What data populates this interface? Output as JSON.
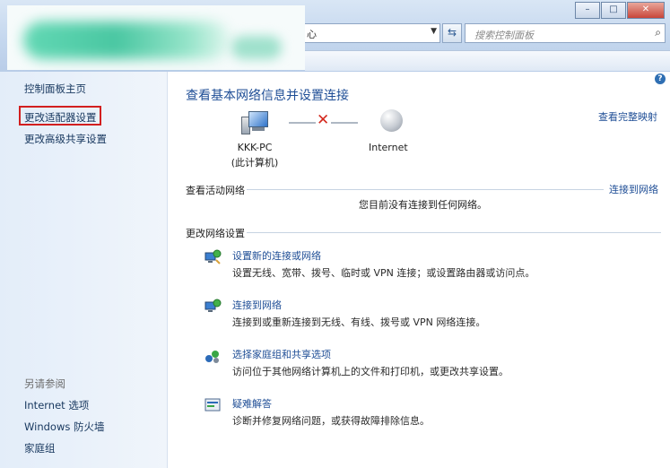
{
  "address": {
    "text": "心"
  },
  "search": {
    "placeholder": "搜索控制面板"
  },
  "window_buttons": {
    "minimize": "–",
    "maximize": "□",
    "close": "✕"
  },
  "left_pane": {
    "home": "控制面板主页",
    "change_adapter": "更改适配器设置",
    "advanced_sharing": "更改高级共享设置",
    "see_also": "另请参阅",
    "internet_options": "Internet 选项",
    "firewall": "Windows 防火墙",
    "homegroup": "家庭组"
  },
  "main": {
    "heading": "查看基本网络信息并设置连接",
    "full_map": "查看完整映射",
    "computer_name": "KKK-PC",
    "computer_sub": "(此计算机)",
    "internet_label": "Internet",
    "active_header": "查看活动网络",
    "connect_to_network": "连接到网络",
    "no_connection": "您目前没有连接到任何网络。",
    "change_header": "更改网络设置",
    "tasks": [
      {
        "icon": "network-setup-icon",
        "title": "设置新的连接或网络",
        "desc": "设置无线、宽带、拨号、临时或 VPN 连接；或设置路由器或访问点。"
      },
      {
        "icon": "connect-network-icon",
        "title": "连接到网络",
        "desc": "连接到或重新连接到无线、有线、拨号或 VPN 网络连接。"
      },
      {
        "icon": "homegroup-sharing-icon",
        "title": "选择家庭组和共享选项",
        "desc": "访问位于其他网络计算机上的文件和打印机，或更改共享设置。"
      },
      {
        "icon": "troubleshoot-icon",
        "title": "疑难解答",
        "desc": "诊断并修复网络问题，或获得故障排除信息。"
      }
    ]
  },
  "colors": {
    "link": "#1f4e96",
    "highlight_box": "#d21f1f",
    "error_x": "#d42a1f"
  }
}
